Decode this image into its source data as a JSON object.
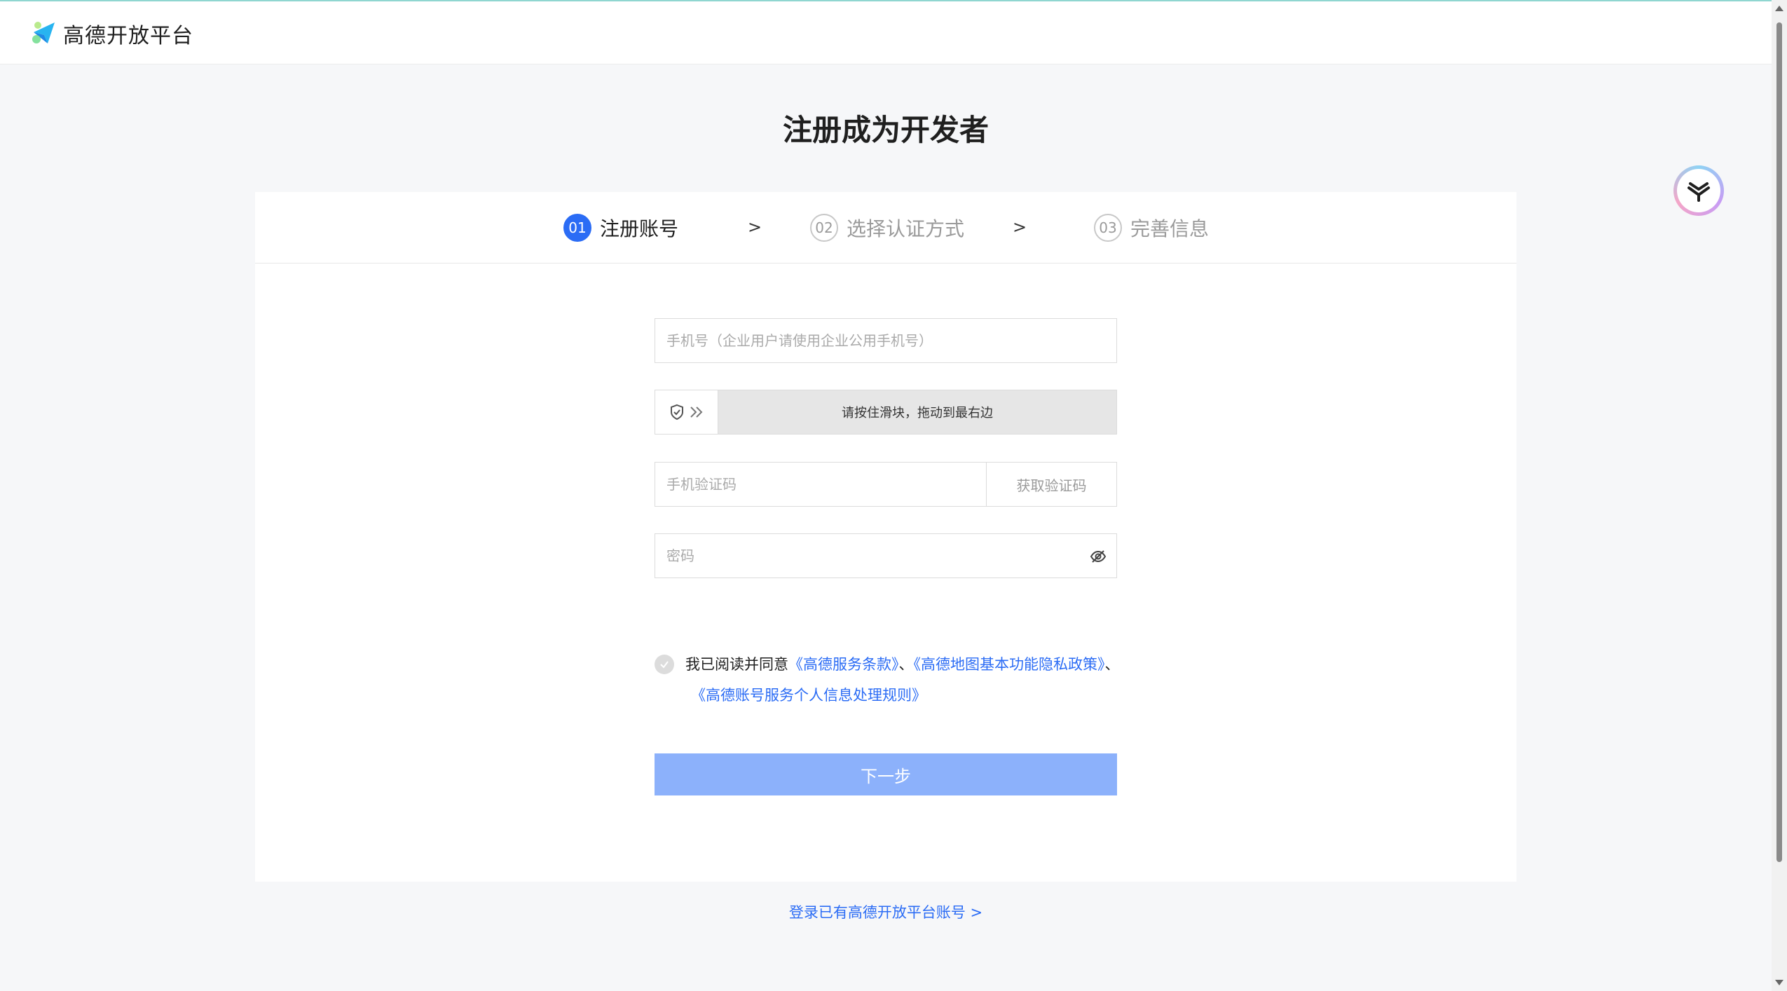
{
  "brand": {
    "name": "高德开放平台"
  },
  "page": {
    "title": "注册成为开发者"
  },
  "steps": [
    {
      "num": "01",
      "label": "注册账号",
      "active": true
    },
    {
      "num": "02",
      "label": "选择认证方式",
      "active": false
    },
    {
      "num": "03",
      "label": "完善信息",
      "active": false
    }
  ],
  "step_separator": ">",
  "form": {
    "phone_placeholder": "手机号（企业用户请使用企业公用手机号）",
    "slider_text": "请按住滑块，拖动到最右边",
    "code_placeholder": "手机验证码",
    "code_button": "获取验证码",
    "password_placeholder": "密码"
  },
  "agreement": {
    "prefix": "我已阅读并同意",
    "link1": "《高德服务条款》",
    "sep": "、",
    "link2": "《高德地图基本功能隐私政策》",
    "link3": "《高德账号服务个人信息处理规则》"
  },
  "next_button": "下一步",
  "login_link": "登录已有高德开放平台账号 >",
  "colors": {
    "primary": "#2b6cf5",
    "primary_disabled": "#8cb1fb",
    "background": "#f6f7f9"
  },
  "icons": [
    "logo-icon",
    "shield-icon",
    "double-chevron-icon",
    "eye-off-icon",
    "check-icon",
    "assistant-icon"
  ]
}
